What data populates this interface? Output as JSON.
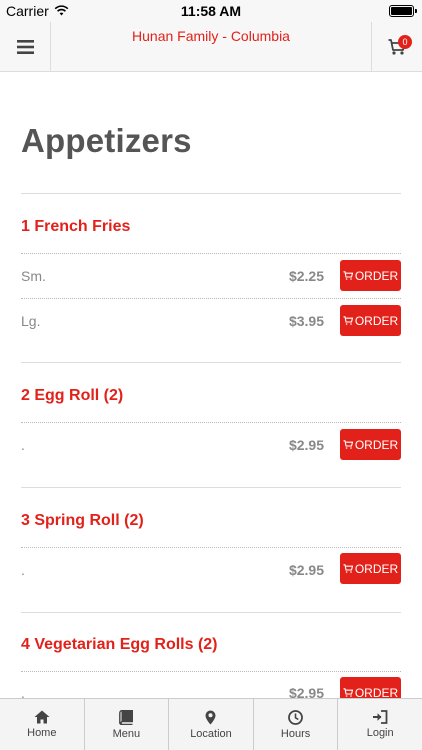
{
  "status_bar": {
    "carrier": "Carrier",
    "time": "11:58 AM"
  },
  "nav": {
    "title": "Hunan Family - Columbia",
    "cart_count": "0"
  },
  "section": {
    "title": "Appetizers"
  },
  "order_label": "ORDER",
  "items": [
    {
      "name": "1 French Fries",
      "options": [
        {
          "size": "Sm.",
          "price": "$2.25"
        },
        {
          "size": "Lg.",
          "price": "$3.95"
        }
      ]
    },
    {
      "name": "2 Egg Roll (2)",
      "options": [
        {
          "size": ".",
          "price": "$2.95"
        }
      ]
    },
    {
      "name": "3 Spring Roll (2)",
      "options": [
        {
          "size": ".",
          "price": "$2.95"
        }
      ]
    },
    {
      "name": "4 Vegetarian Egg Rolls (2)",
      "options": [
        {
          "size": ".",
          "price": "$2.95"
        }
      ]
    }
  ],
  "tabs": [
    {
      "label": "Home",
      "icon": "home-icon"
    },
    {
      "label": "Menu",
      "icon": "book-icon"
    },
    {
      "label": "Location",
      "icon": "map-pin-icon"
    },
    {
      "label": "Hours",
      "icon": "clock-icon"
    },
    {
      "label": "Login",
      "icon": "login-icon"
    }
  ],
  "colors": {
    "brand": "#e2221a",
    "heading": "#555555",
    "muted": "#888888"
  }
}
